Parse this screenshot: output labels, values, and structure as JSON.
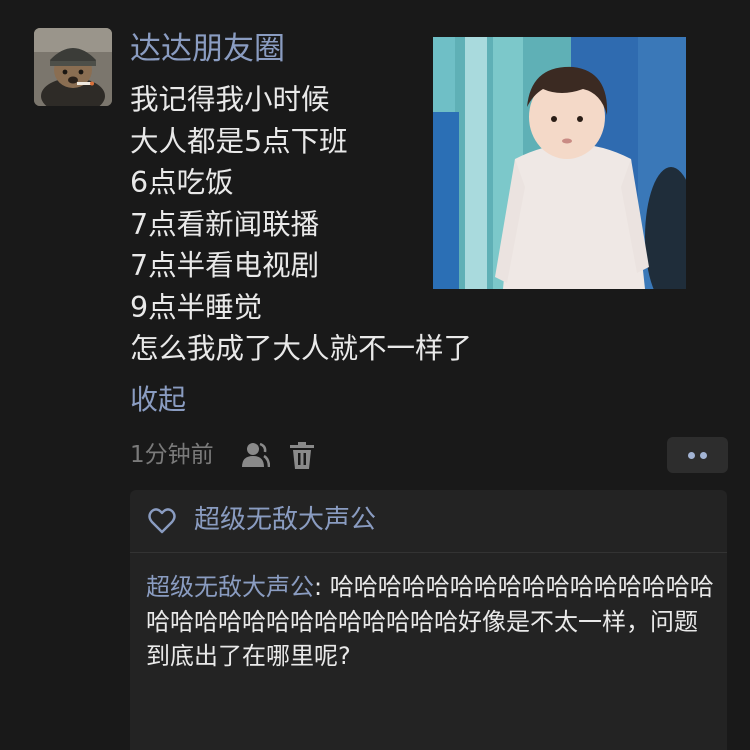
{
  "post": {
    "author": "达达朋友圈",
    "lines": [
      "我记得我小时候",
      "大人都是5点下班",
      "6点吃饭",
      "7点看新闻联播",
      "7点半看电视剧",
      "9点半睡觉",
      "怎么我成了大人就不一样了"
    ],
    "collapse_label": "收起",
    "time": "1分钟前"
  },
  "likes": {
    "name": "超级无敌大声公"
  },
  "comment": {
    "author": "超级无敌大声公",
    "separator": ": ",
    "text": "哈哈哈哈哈哈哈哈哈哈哈哈哈哈哈哈哈哈哈哈哈哈哈哈哈哈哈哈哈好像是不太一样，问题到底出了在哪里呢?"
  },
  "icons": {
    "visibility": "person-icon",
    "delete": "trash-icon",
    "more": "more-dots-icon",
    "like": "heart-icon"
  },
  "colors": {
    "background": "#191919",
    "link": "#8a9cc1",
    "text": "#e9e9e9",
    "muted": "#7a7a7a",
    "panel": "#232323"
  }
}
